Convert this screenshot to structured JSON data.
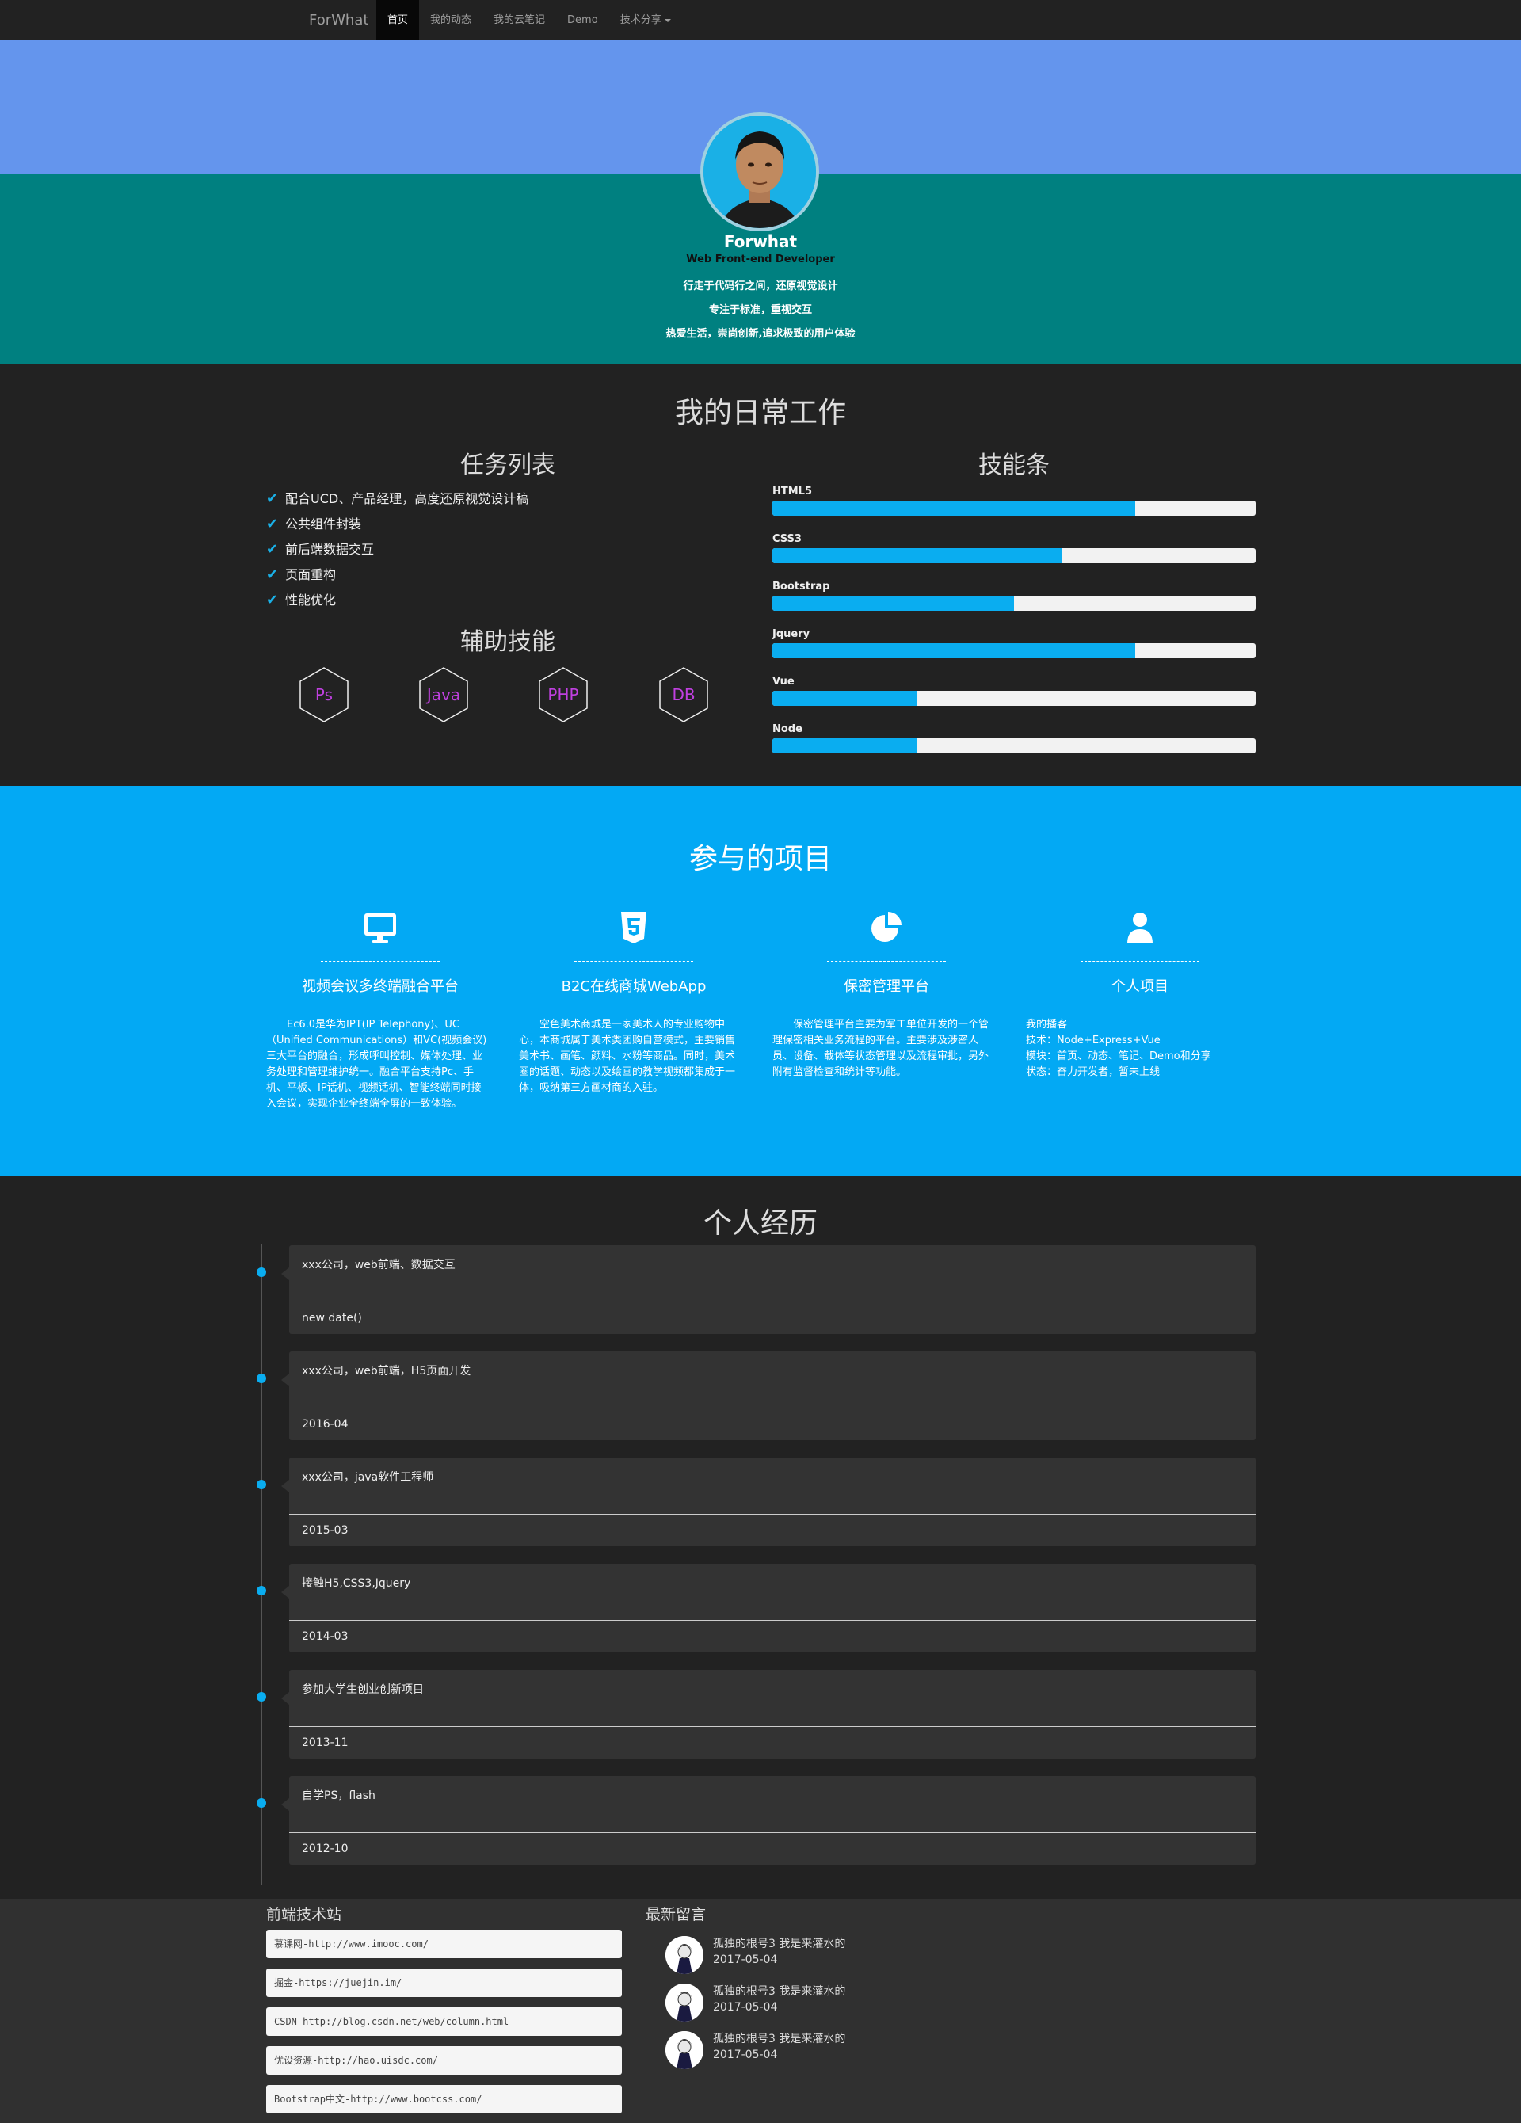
{
  "nav": {
    "brand": "ForWhat",
    "items": [
      {
        "label": "首页",
        "active": true
      },
      {
        "label": "我的动态"
      },
      {
        "label": "我的云笔记"
      },
      {
        "label": "Demo"
      },
      {
        "label": "技术分享",
        "dropdown": true
      }
    ]
  },
  "hero": {
    "name": "Forwhat",
    "title": "Web Front-end Developer",
    "lines": [
      "行走于代码行之间，还原视觉设计",
      "专注于标准，重视交互",
      "热爱生活，崇尚创新,追求极致的用户体验"
    ]
  },
  "work": {
    "title": "我的日常工作",
    "tasks_title": "任务列表",
    "tasks": [
      "配合UCD、产品经理，高度还原视觉设计稿",
      "公共组件封装",
      "前后端数据交互",
      "页面重构",
      "性能优化"
    ],
    "aux_title": "辅助技能",
    "aux": [
      "Ps",
      "Java",
      "PHP",
      "DB"
    ],
    "skills_title": "技能条",
    "skills": [
      {
        "name": "HTML5",
        "level": 0.75
      },
      {
        "name": "CSS3",
        "level": 0.6
      },
      {
        "name": "Bootstrap",
        "level": 0.5
      },
      {
        "name": "Jquery",
        "level": 0.75
      },
      {
        "name": "Vue",
        "level": 0.3
      },
      {
        "name": "Node",
        "level": 0.3
      }
    ]
  },
  "projects": {
    "title": "参与的项目",
    "items": [
      {
        "icon": "monitor-icon",
        "name": "视频会议多终端融合平台",
        "desc": "Ec6.0是华为IPT(IP Telephony)、UC（Unified Communications）和VC(视频会议)三大平台的融合，形成呼叫控制、媒体处理、业务处理和管理维护统一。融合平台支持Pc、手机、平板、IP话机、视频话机、智能终端同时接入会议，实现企业全终端全屏的一致体验。"
      },
      {
        "icon": "html5-icon",
        "name": "B2C在线商城WebApp",
        "desc": "空色美术商城是一家美术人的专业购物中心，本商城属于美术类团购自营模式，主要销售美术书、画笔、颜料、水粉等商品。同时，美术圈的话题、动态以及绘画的教学视频都集成于一体，吸纳第三方画材商的入驻。"
      },
      {
        "icon": "pie-chart-icon",
        "name": "保密管理平台",
        "desc": "保密管理平台主要为军工单位开发的一个管理保密相关业务流程的平台。主要涉及涉密人员、设备、载体等状态管理以及流程审批，另外附有监督检查和统计等功能。"
      },
      {
        "icon": "user-icon",
        "name": "个人项目",
        "desc_lines": [
          "我的播客",
          "技术：Node+Express+Vue",
          "模块：首页、动态、笔记、Demo和分享",
          "状态：奋力开发者，暂未上线"
        ]
      }
    ]
  },
  "experience": {
    "title": "个人经历",
    "items": [
      {
        "text": "xxx公司，web前端、数据交互",
        "date": "new date()"
      },
      {
        "text": "xxx公司，web前端，H5页面开发",
        "date": "2016-04"
      },
      {
        "text": "xxx公司，java软件工程师",
        "date": "2015-03"
      },
      {
        "text": "接触H5,CSS3,Jquery",
        "date": "2014-03"
      },
      {
        "text": "参加大学生创业创新项目",
        "date": "2013-11"
      },
      {
        "text": "自学PS，flash",
        "date": "2012-10"
      }
    ]
  },
  "footer": {
    "links_title": "前端技术站",
    "links": [
      "慕课网-http://www.imooc.com/",
      "掘金-https://juejin.im/",
      "CSDN-http://blog.csdn.net/web/column.html",
      "优设资源-http://hao.uisdc.com/",
      "Bootstrap中文-http://www.bootcss.com/"
    ],
    "messages_title": "最新留言",
    "messages": [
      {
        "text": "孤独的根号3 我是来灌水的",
        "date": "2017-05-04"
      },
      {
        "text": "孤独的根号3 我是来灌水的",
        "date": "2017-05-04"
      },
      {
        "text": "孤独的根号3 我是来灌水的",
        "date": "2017-05-04"
      }
    ]
  },
  "colors": {
    "accent": "#03a9f4",
    "hero_top": "#6495ed",
    "hero_bottom": "#008080",
    "dark": "#222222"
  }
}
